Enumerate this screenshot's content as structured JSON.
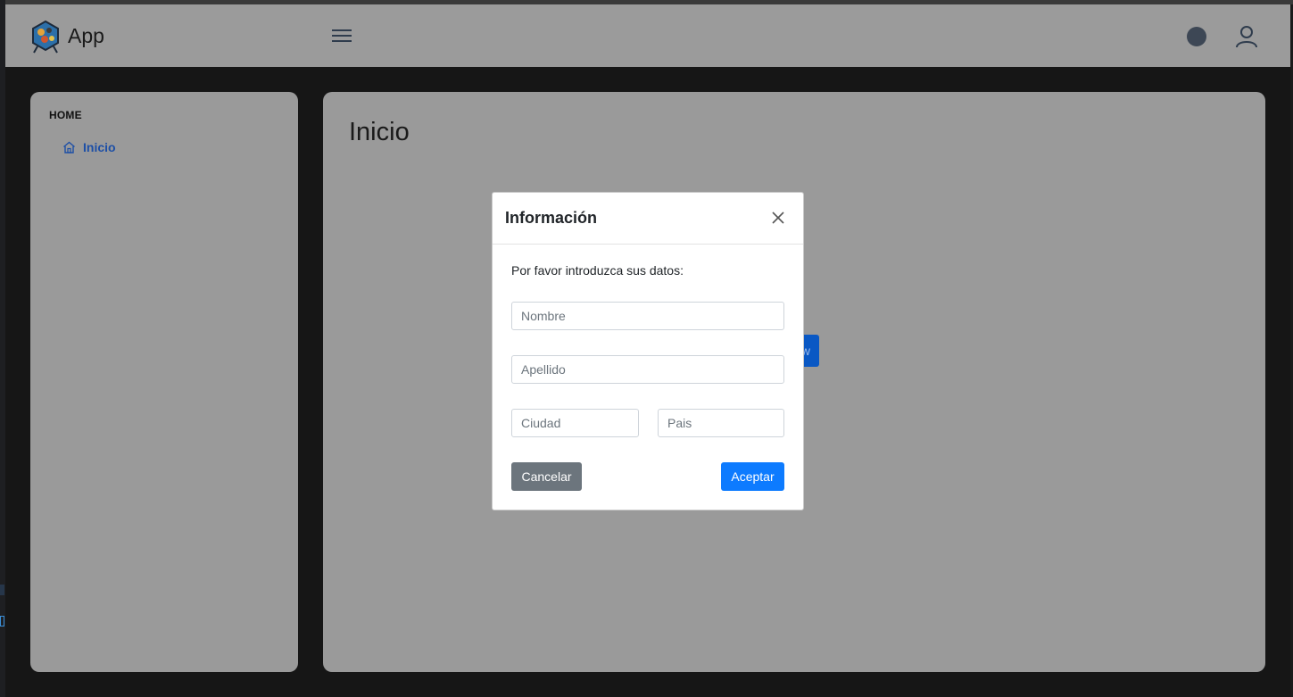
{
  "header": {
    "app_title": "App",
    "menu_icon": "hamburger-menu-icon",
    "status_icon": "circle-icon",
    "user_icon": "user-icon"
  },
  "sidebar": {
    "section_heading": "HOME",
    "items": [
      {
        "label": "Inicio",
        "icon": "home-icon",
        "active": true
      }
    ]
  },
  "main": {
    "page_title": "Inicio",
    "partially_hidden_button_text": "w"
  },
  "modal": {
    "title": "Información",
    "close_icon": "close-icon",
    "prompt": "Por favor introduzca sus datos:",
    "fields": {
      "nombre": {
        "placeholder": "Nombre",
        "value": ""
      },
      "apellido": {
        "placeholder": "Apellido",
        "value": ""
      },
      "ciudad": {
        "placeholder": "Ciudad",
        "value": ""
      },
      "pais": {
        "placeholder": "Pais",
        "value": ""
      }
    },
    "cancel_label": "Cancelar",
    "accept_label": "Aceptar"
  },
  "colors": {
    "accent": "#0d7bff",
    "secondary": "#6c757d",
    "link": "#1d4fa6",
    "overlay": "#9a9a9a"
  }
}
